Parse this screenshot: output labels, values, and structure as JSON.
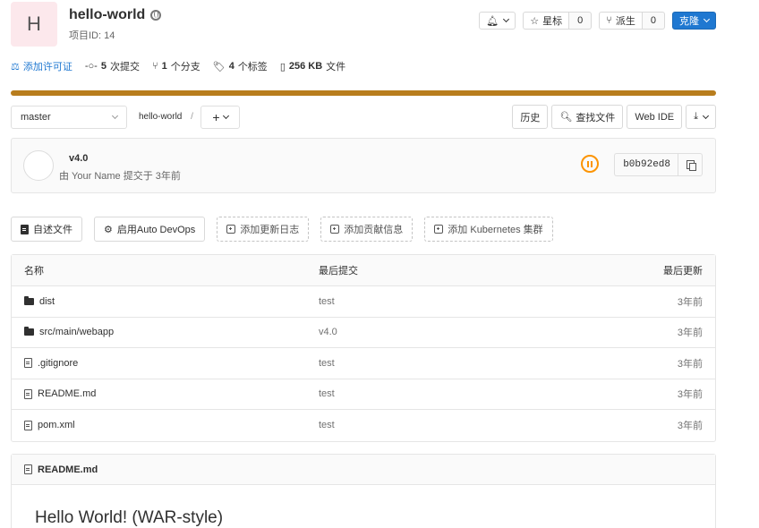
{
  "project": {
    "avatar_letter": "H",
    "name": "hello-world",
    "id_label": "项目ID: 14"
  },
  "header_actions": {
    "star_label": "星标",
    "star_count": "0",
    "fork_label": "派生",
    "fork_count": "0",
    "clone_label": "克隆"
  },
  "stats": {
    "add_license": "添加许可证",
    "commits_num": "5",
    "commits_label": "次提交",
    "branches_num": "1",
    "branches_label": "个分支",
    "tags_num": "4",
    "tags_label": "个标签",
    "size_num": "256 KB",
    "size_label": "文件"
  },
  "language_bar": {
    "color": "#b87d1d",
    "fraction": 1.0
  },
  "nav": {
    "branch": "master",
    "breadcrumb_root": "hello-world",
    "breadcrumb_sep": "/",
    "history": "历史",
    "find_file": "查找文件",
    "web_ide": "Web IDE"
  },
  "commit": {
    "title": "v4.0",
    "meta": "由 Your Name 提交于 3年前",
    "sha": "b0b92ed8",
    "pipeline_status_color": "#fc9403"
  },
  "quick_actions": {
    "readme": "自述文件",
    "auto_devops": "启用Auto DevOps",
    "changelog": "添加更新日志",
    "contributing": "添加贡献信息",
    "kubernetes": "添加 Kubernetes 集群"
  },
  "file_table": {
    "headers": {
      "name": "名称",
      "last_commit": "最后提交",
      "last_update": "最后更新"
    },
    "rows": [
      {
        "name": "dist",
        "type": "folder",
        "commit": "test",
        "date": "3年前"
      },
      {
        "name": "src/main/webapp",
        "type": "folder",
        "commit": "v4.0",
        "date": "3年前"
      },
      {
        "name": ".gitignore",
        "type": "file",
        "commit": "test",
        "date": "3年前"
      },
      {
        "name": "README.md",
        "type": "file",
        "commit": "test",
        "date": "3年前"
      },
      {
        "name": "pom.xml",
        "type": "file",
        "commit": "test",
        "date": "3年前"
      }
    ]
  },
  "readme": {
    "filename": "README.md",
    "heading": "Hello World! (WAR-style)"
  }
}
